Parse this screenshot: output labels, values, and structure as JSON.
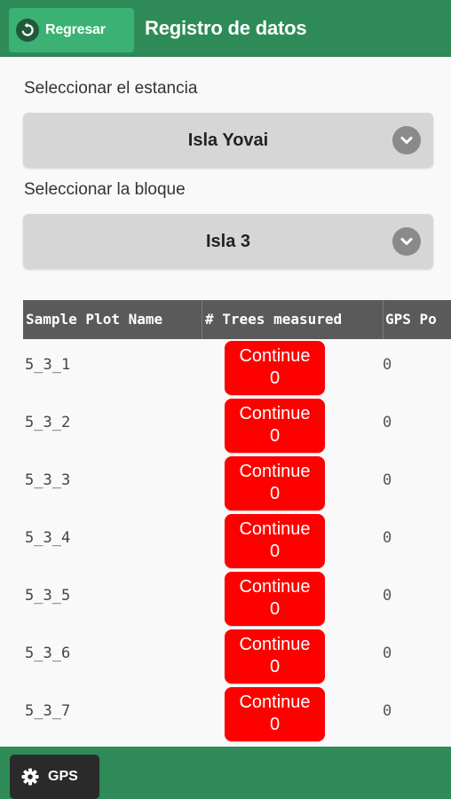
{
  "header": {
    "back_label": "Regresar",
    "title": "Registro de datos",
    "back_icon": "back-arrow-icon"
  },
  "estancia": {
    "label": "Seleccionar el estancia",
    "selected": "Isla Yovai"
  },
  "bloque": {
    "label": "Seleccionar la bloque",
    "selected": "Isla 3"
  },
  "table": {
    "columns": [
      "Sample Plot Name",
      "# Trees measured",
      "GPS Po"
    ],
    "rows": [
      {
        "name": "5_3_1",
        "button": "Continue",
        "trees": "0",
        "gps": "0"
      },
      {
        "name": "5_3_2",
        "button": "Continue",
        "trees": "0",
        "gps": "0"
      },
      {
        "name": "5_3_3",
        "button": "Continue",
        "trees": "0",
        "gps": "0"
      },
      {
        "name": "5_3_4",
        "button": "Continue",
        "trees": "0",
        "gps": "0"
      },
      {
        "name": "5_3_5",
        "button": "Continue",
        "trees": "0",
        "gps": "0"
      },
      {
        "name": "5_3_6",
        "button": "Continue",
        "trees": "0",
        "gps": "0"
      },
      {
        "name": "5_3_7",
        "button": "Continue",
        "trees": "0",
        "gps": "0"
      }
    ]
  },
  "footer": {
    "gps_label": "GPS",
    "gps_icon": "gear-icon"
  },
  "colors": {
    "header_bg": "#2e8b57",
    "back_button_bg": "#3bb273",
    "continue_button_bg": "#ff0000",
    "table_header_bg": "#5a5a5a",
    "gps_button_bg": "#2a2a2a"
  }
}
